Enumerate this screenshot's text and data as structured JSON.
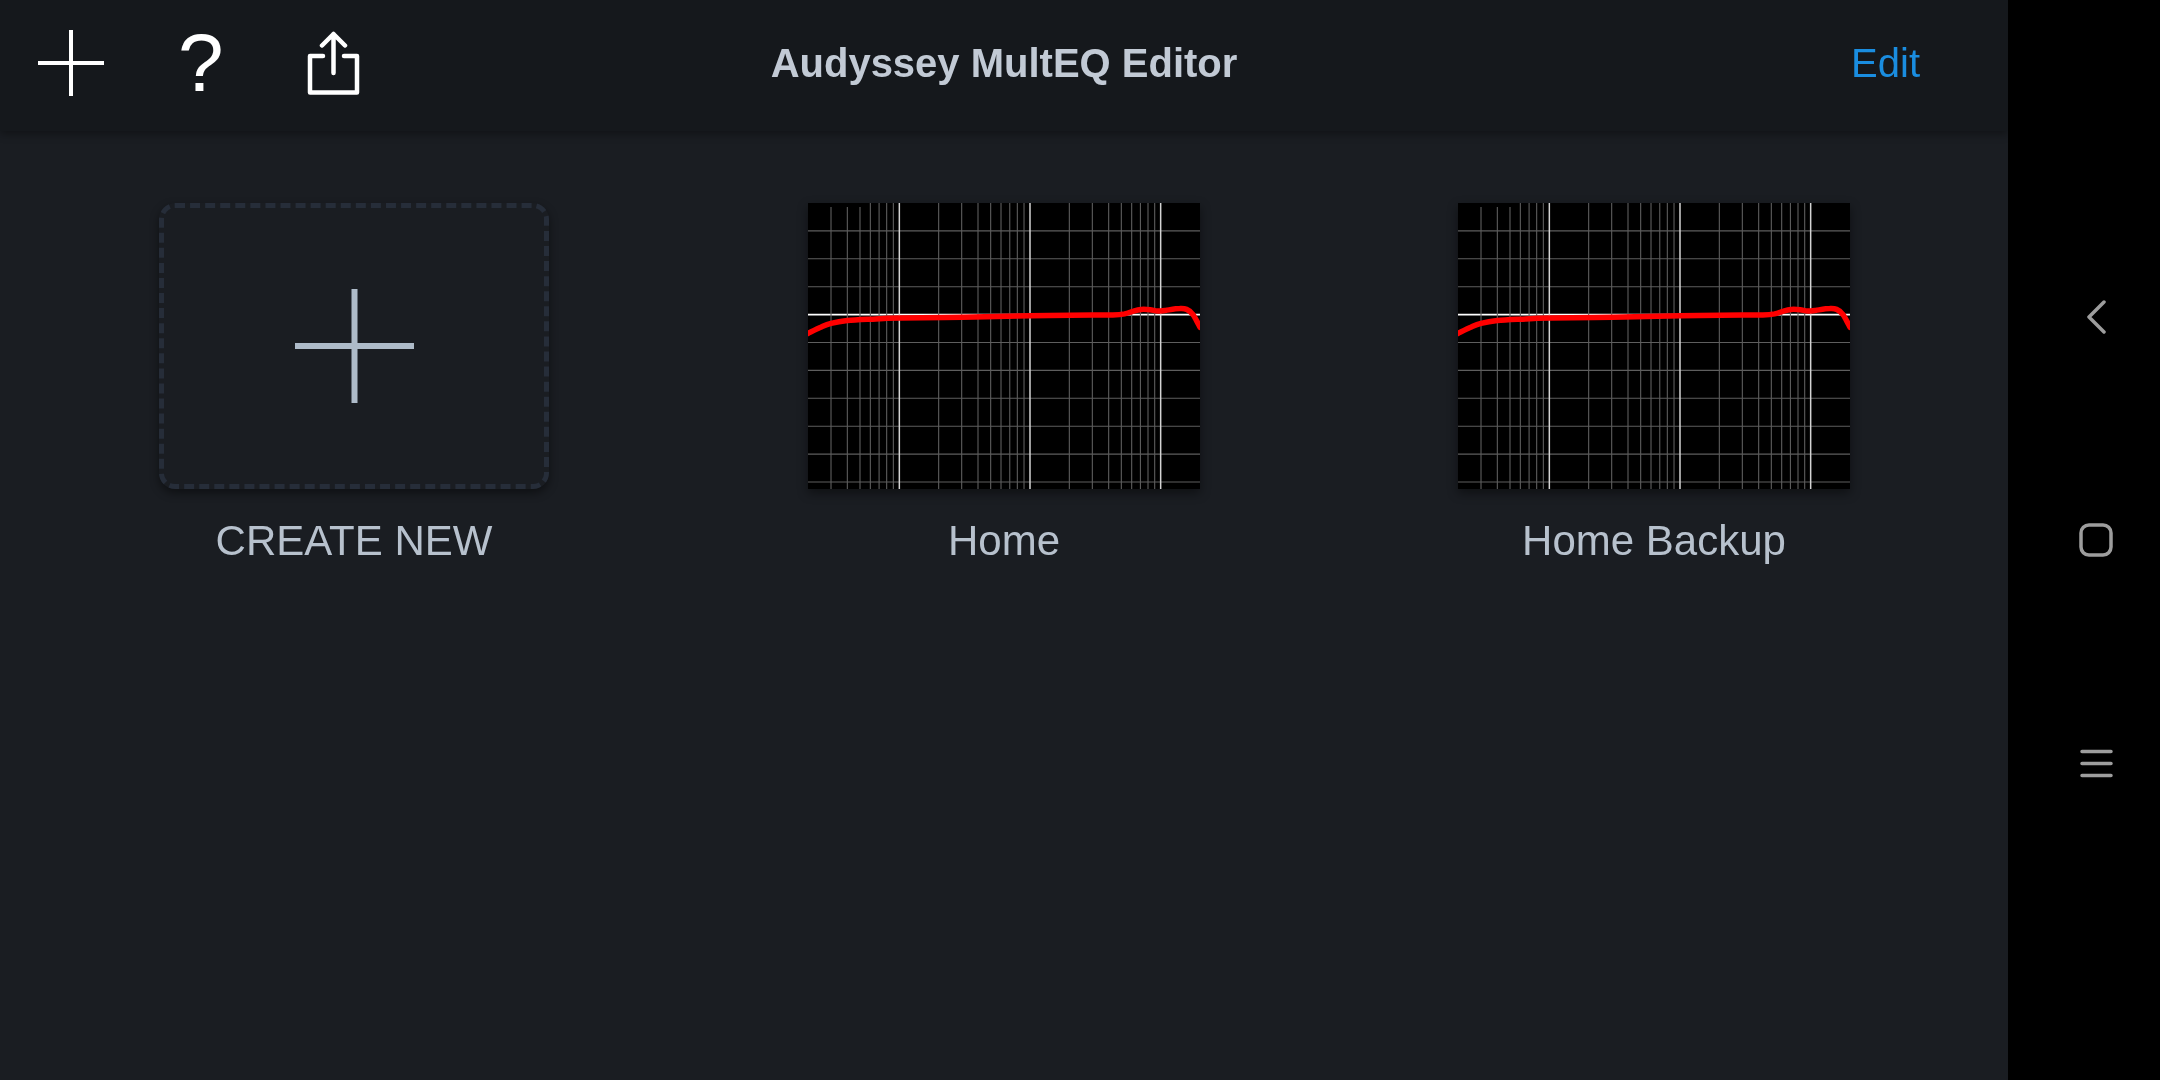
{
  "toolbar": {
    "help": "?",
    "title": "Audyssey MultEQ Editor",
    "action": "Edit"
  },
  "tiles": [
    {
      "kind": "create",
      "label": "CREATE NEW"
    },
    {
      "kind": "preset",
      "label": "Home"
    },
    {
      "kind": "preset",
      "label": "Home Backup"
    }
  ]
}
